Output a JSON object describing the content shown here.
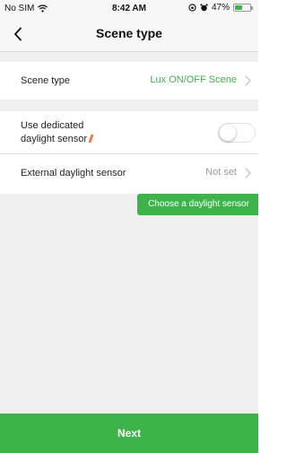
{
  "status_bar": {
    "carrier": "No SIM",
    "time": "8:42 AM",
    "battery": "47%",
    "battery_level": 0.47
  },
  "nav": {
    "title": "Scene type"
  },
  "rows": {
    "scene_type": {
      "label": "Scene type",
      "value": "Lux ON/OFF Scene"
    },
    "dedicated_sensor": {
      "label_line1": "Use dedicated",
      "label_line2": "daylight sensor",
      "toggle_on": false
    },
    "external_sensor": {
      "label": "External daylight sensor",
      "value": "Not set"
    }
  },
  "tooltip": {
    "text": "Choose a daylight sensor"
  },
  "footer": {
    "next_label": "Next"
  },
  "colors": {
    "accent": "#3cb44a",
    "info_icon": "#f0783a",
    "muted_text": "#9a9a9a",
    "background": "#efeff0"
  }
}
